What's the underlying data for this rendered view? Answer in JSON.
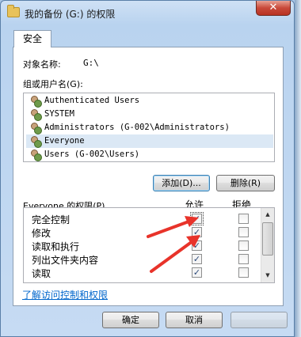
{
  "window": {
    "title": "我的备份 (G:) 的权限",
    "close_label": "✕"
  },
  "tab": {
    "label": "安全"
  },
  "object": {
    "label": "对象名称:",
    "value": "G:\\"
  },
  "users": {
    "label": "组或用户名(G):",
    "items": [
      "Authenticated Users",
      "SYSTEM",
      "Administrators (G-002\\Administrators)",
      "Everyone",
      "Users (G-002\\Users)"
    ],
    "selected": "Everyone"
  },
  "buttons": {
    "add": "添加(D)...",
    "remove": "删除(R)",
    "ok": "确定",
    "cancel": "取消"
  },
  "permissions": {
    "label": "Everyone 的权限(P)",
    "allow_header": "允许",
    "deny_header": "拒绝",
    "rows": [
      {
        "name": "完全控制",
        "allow": true,
        "deny": false
      },
      {
        "name": "修改",
        "allow": true,
        "deny": false
      },
      {
        "name": "读取和执行",
        "allow": true,
        "deny": false
      },
      {
        "name": "列出文件夹内容",
        "allow": true,
        "deny": false
      },
      {
        "name": "读取",
        "allow": true,
        "deny": false
      }
    ]
  },
  "link": {
    "text": "了解访问控制和权限"
  },
  "annotation_color": "#e8332a"
}
